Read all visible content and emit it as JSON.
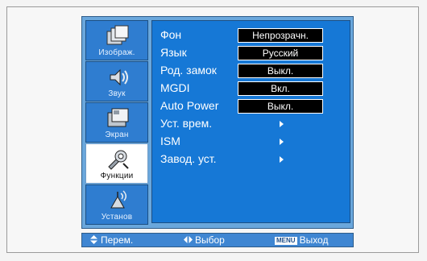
{
  "sidebar": {
    "items": [
      {
        "label": "Изображ.",
        "icon": "picture-icon"
      },
      {
        "label": "Звук",
        "icon": "speaker-icon"
      },
      {
        "label": "Экран",
        "icon": "screen-icon"
      },
      {
        "label": "Функции",
        "icon": "functions-icon"
      },
      {
        "label": "Установ",
        "icon": "antenna-icon"
      }
    ],
    "active_index": 3
  },
  "menu": {
    "rows": [
      {
        "name": "Фон",
        "value": "Непрозрачн."
      },
      {
        "name": "Язык",
        "value": "Русский"
      },
      {
        "name": "Род. замок",
        "value": "Выкл."
      },
      {
        "name": "MGDI",
        "value": "Вкл."
      },
      {
        "name": "Auto Power",
        "value": "Выкл."
      },
      {
        "name": "Уст. врем."
      },
      {
        "name": "ISM"
      },
      {
        "name": "Завод. уст."
      }
    ]
  },
  "bottom_bar": {
    "move_label": "Перем.",
    "select_label": "Выбор",
    "menu_key": "MENU",
    "exit_label": "Выход"
  },
  "colors": {
    "osd_background": "#6aa7dc",
    "panel": "#1678d6",
    "sidebar_item": "#2f7dd0",
    "value_box": "#000000"
  }
}
